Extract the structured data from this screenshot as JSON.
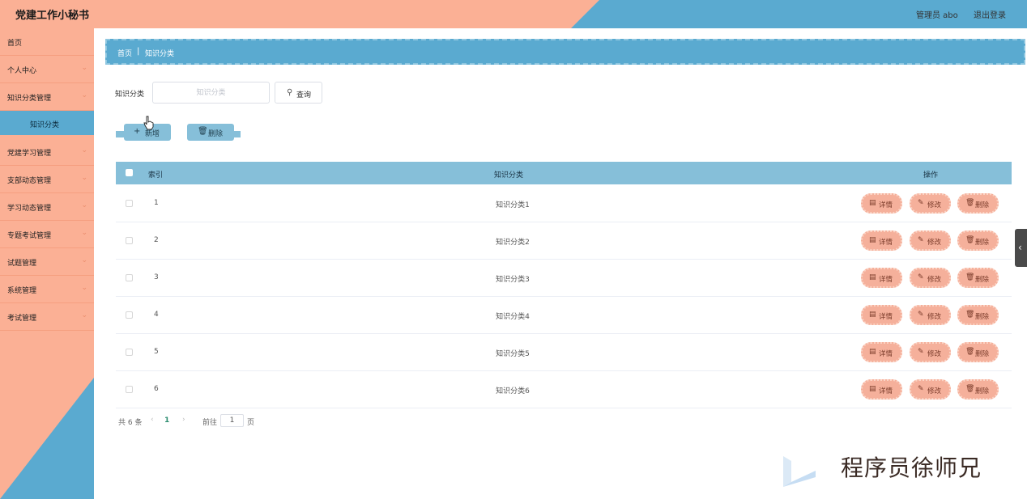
{
  "header": {
    "title": "党建工作小秘书",
    "user": "管理员 abo",
    "logout": "退出登录"
  },
  "colors": {
    "peach": "#fbb095",
    "blue": "#5aaad0",
    "table_header": "#86bfd9",
    "op_button": "#f5b09b"
  },
  "sidebar": {
    "items": [
      {
        "label": "首页",
        "has_chevron": false
      },
      {
        "label": "个人中心",
        "has_chevron": true
      },
      {
        "label": "知识分类管理",
        "has_chevron": true
      },
      {
        "label": "党建学习管理",
        "has_chevron": true
      },
      {
        "label": "支部动态管理",
        "has_chevron": true
      },
      {
        "label": "学习动态管理",
        "has_chevron": true
      },
      {
        "label": "专题考试管理",
        "has_chevron": true
      },
      {
        "label": "试题管理",
        "has_chevron": true
      },
      {
        "label": "系统管理",
        "has_chevron": true
      },
      {
        "label": "考试管理",
        "has_chevron": true
      }
    ],
    "active_sub": "知识分类",
    "chevron_icon": "chevron-down-icon"
  },
  "breadcrumb": {
    "home": "首页",
    "separator": "|",
    "current": "知识分类"
  },
  "search": {
    "label": "知识分类",
    "placeholder": "知识分类",
    "value": "",
    "button_label": "查询",
    "button_icon": "search-icon"
  },
  "actions": {
    "add_label": "新增",
    "add_icon": "plus-icon",
    "delete_label": "删除",
    "delete_icon": "trash-icon"
  },
  "table": {
    "headers": {
      "index": "索引",
      "name": "知识分类",
      "ops": "操作"
    },
    "rows": [
      {
        "index": "1",
        "name": "知识分类1"
      },
      {
        "index": "2",
        "name": "知识分类2"
      },
      {
        "index": "3",
        "name": "知识分类3"
      },
      {
        "index": "4",
        "name": "知识分类4"
      },
      {
        "index": "5",
        "name": "知识分类5"
      },
      {
        "index": "6",
        "name": "知识分类6"
      }
    ],
    "ops": {
      "detail": "详情",
      "edit": "修改",
      "delete": "删除"
    }
  },
  "pagination": {
    "total": "共 6 条",
    "prev": "‹",
    "current": "1",
    "next": "›",
    "goto_label": "前往",
    "goto_value": "1",
    "page_unit": "页"
  },
  "watermark": {
    "text": "程序员徐师兄"
  }
}
